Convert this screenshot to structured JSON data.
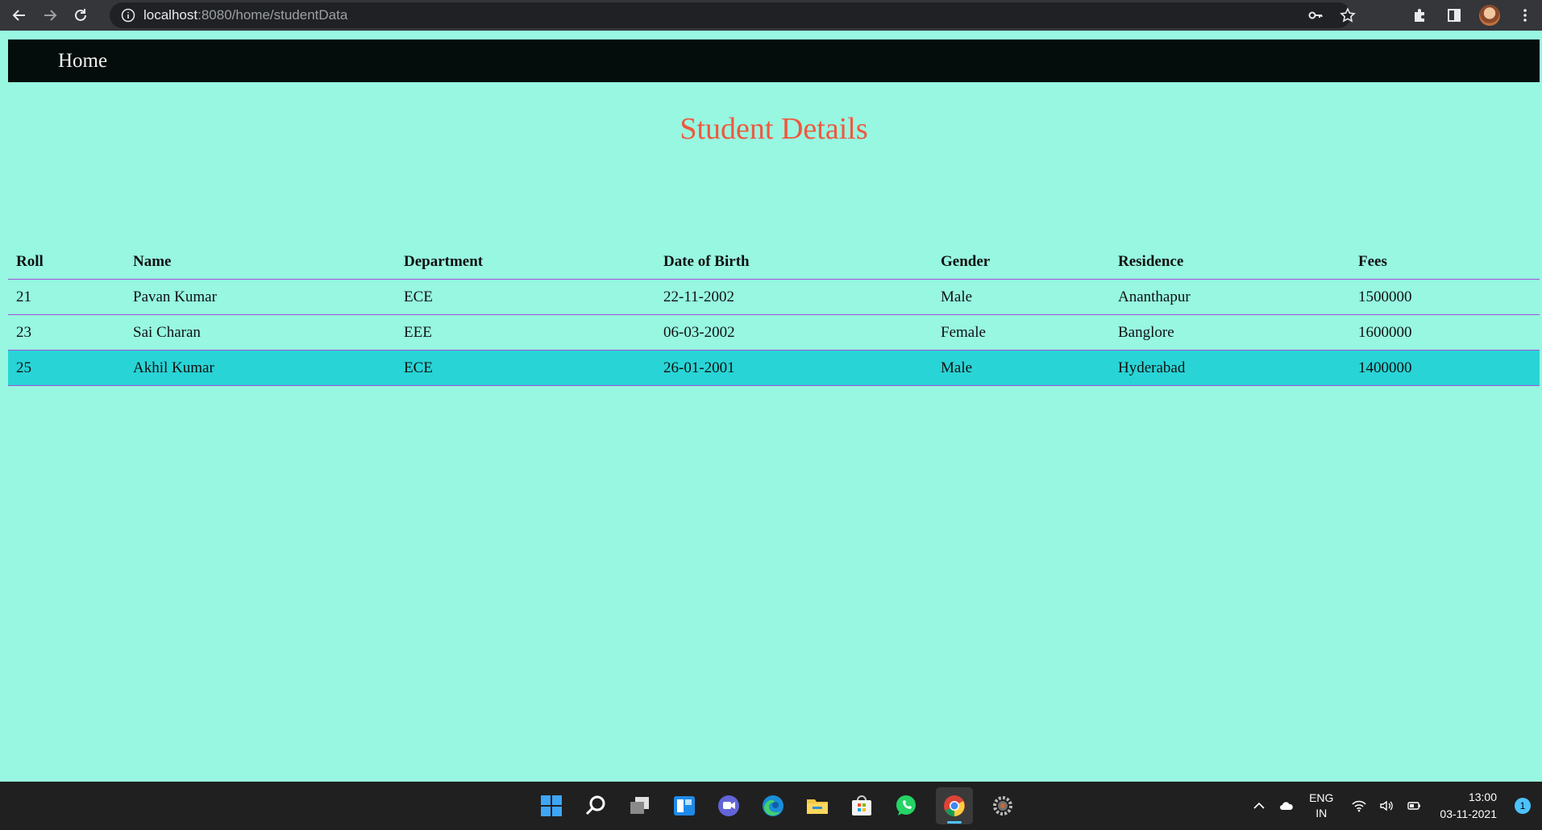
{
  "browser": {
    "url_host": "localhost",
    "url_path": ":8080/home/studentData"
  },
  "nav": {
    "home_label": "Home"
  },
  "page": {
    "title": "Student Details"
  },
  "table": {
    "headers": [
      "Roll",
      "Name",
      "Department",
      "Date of Birth",
      "Gender",
      "Residence",
      "Fees"
    ],
    "rows": [
      [
        "21",
        "Pavan Kumar",
        "ECE",
        "22-11-2002",
        "Male",
        "Ananthapur",
        "1500000"
      ],
      [
        "23",
        "Sai Charan",
        "EEE",
        "06-03-2002",
        "Female",
        "Banglore",
        "1600000"
      ],
      [
        "25",
        "Akhil Kumar",
        "ECE",
        "26-01-2001",
        "Male",
        "Hyderabad",
        "1400000"
      ]
    ],
    "highlighted_row": 2
  },
  "colors": {
    "page_background": "#97f7e1",
    "nav_background": "#040d0b",
    "title_color": "#f0583e",
    "row_border": "#a64fd9",
    "highlight_row": "#29d4d6"
  },
  "taskbar": {
    "apps": [
      "windows-start-icon",
      "search-icon",
      "task-view-icon",
      "widgets-icon",
      "teams-chat-icon",
      "edge-icon",
      "file-explorer-icon",
      "microsoft-store-icon",
      "whatsapp-icon",
      "chrome-icon",
      "settings-icon"
    ],
    "language": "ENG",
    "region": "IN",
    "time": "13:00",
    "date": "03-11-2021",
    "notification_count": "1"
  }
}
